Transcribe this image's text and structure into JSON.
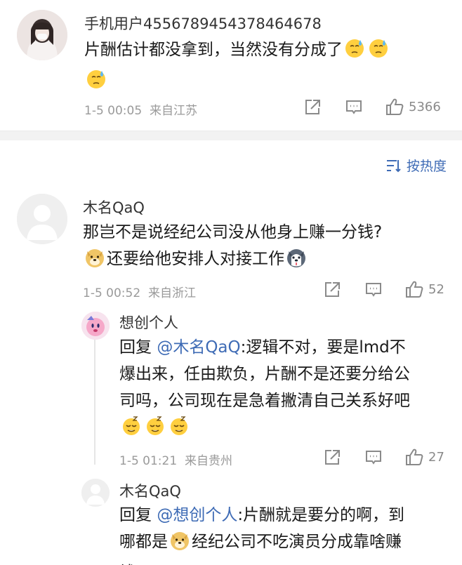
{
  "top_comment": {
    "username": "手机用户4556789454378464678",
    "text_line1": "片酬估计都没拿到，当然没有分成了",
    "emoji": "sweat-face",
    "time": "1-5 00:05",
    "location": "来自江苏",
    "likes": "5366"
  },
  "sort": {
    "label": "按热度"
  },
  "comment": {
    "username": "木名QaQ",
    "text_line1": "那岂不是说经纪公司没从他身上赚一分钱?",
    "text_line2": "还要给他安排人对接工作",
    "time": "1-5 00:52",
    "location": "来自浙江",
    "likes": "52"
  },
  "replies": [
    {
      "username": "想创个人",
      "reply_prefix": "回复",
      "mention": "@木名QaQ",
      "text_a": ":逻辑不对，要是lmd不",
      "text_b": "爆出来，任由欺负，片酬不是还要分给公",
      "text_c": "司吗，公司现在是急着撇清自己关系好吧",
      "time": "1-5 01:21",
      "location": "来自贵州",
      "likes": "27"
    },
    {
      "username": "木名QaQ",
      "reply_prefix": "回复",
      "mention": "@想创个人",
      "text_a": ":片酬就是要分的啊，到",
      "text_b1": "哪都是",
      "text_b2": "经纪公司不吃演员分成靠啥赚",
      "text_c": "钱"
    }
  ],
  "colors": {
    "link": "#3e6bb5",
    "meta": "#9a9a9a",
    "divider": "#f2f2f2"
  }
}
